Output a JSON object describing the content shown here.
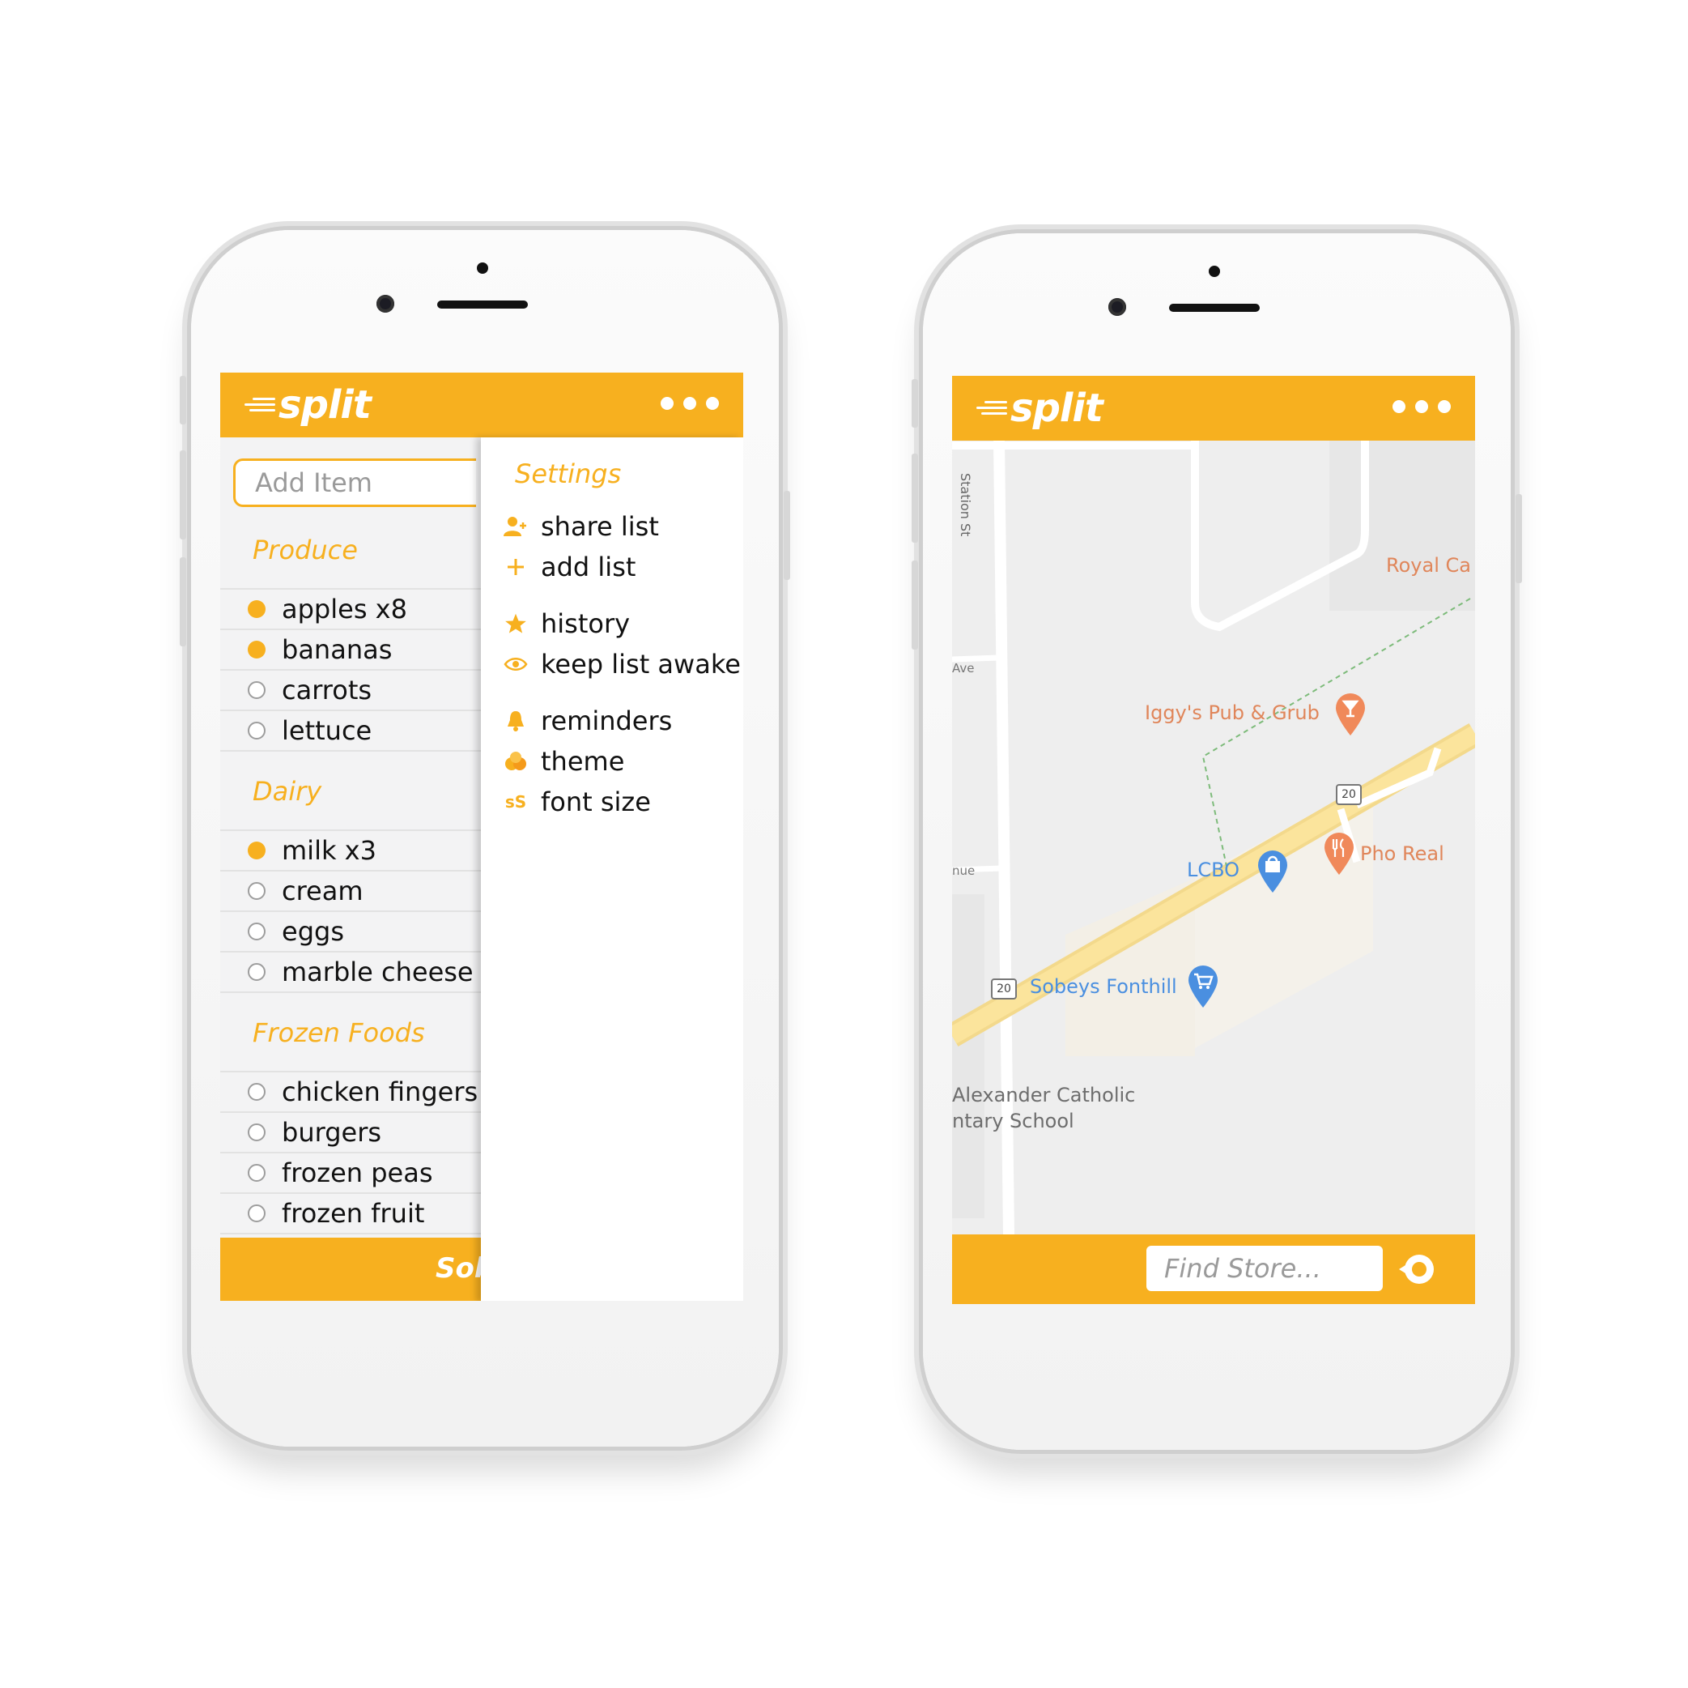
{
  "app": {
    "name": "split"
  },
  "colors": {
    "accent": "#F7B01F",
    "map_blue": "#4A8FE0",
    "map_orange": "#F0895A"
  },
  "list_screen": {
    "add_item_placeholder": "Add Item",
    "sections": [
      {
        "title": "Produce",
        "items": [
          {
            "label": "apples x8",
            "checked": true
          },
          {
            "label": "bananas",
            "checked": true
          },
          {
            "label": "carrots",
            "checked": false
          },
          {
            "label": "lettuce",
            "checked": false
          }
        ]
      },
      {
        "title": "Dairy",
        "items": [
          {
            "label": "milk x3",
            "checked": true
          },
          {
            "label": "cream",
            "checked": false
          },
          {
            "label": "eggs",
            "checked": false
          },
          {
            "label": "marble cheese",
            "checked": false
          }
        ]
      },
      {
        "title": "Frozen Foods",
        "items": [
          {
            "label": "chicken fingers",
            "checked": false
          },
          {
            "label": "burgers",
            "checked": false
          },
          {
            "label": "frozen peas",
            "checked": false
          },
          {
            "label": "frozen fruit",
            "checked": false
          }
        ]
      }
    ],
    "bottom_text": "Sob",
    "settings": {
      "title": "Settings",
      "items": [
        {
          "label": "share list",
          "icon": "add-person-icon"
        },
        {
          "label": "add list",
          "icon": "plus-icon"
        },
        {
          "label": "history",
          "icon": "star-icon"
        },
        {
          "label": "keep list awake",
          "icon": "eye-icon"
        },
        {
          "label": "reminders",
          "icon": "bell-icon"
        },
        {
          "label": "theme",
          "icon": "palette-icon"
        },
        {
          "label": "font size",
          "icon": "font-size-icon",
          "glyph": "sS"
        }
      ]
    }
  },
  "map_screen": {
    "labels": {
      "station_st": "Station St",
      "ave": "Ave",
      "nue": "nue",
      "royal": "Royal Ca",
      "iggys": "Iggy's Pub & Grub",
      "pho_real": "Pho Real",
      "lcbo": "LCBO",
      "sobeys": "Sobeys Fonthill",
      "school_line1": "Alexander Catholic",
      "school_line2": "ntary School",
      "hwy1": "20",
      "hwy2": "20"
    },
    "find_store_placeholder": "Find Store..."
  }
}
